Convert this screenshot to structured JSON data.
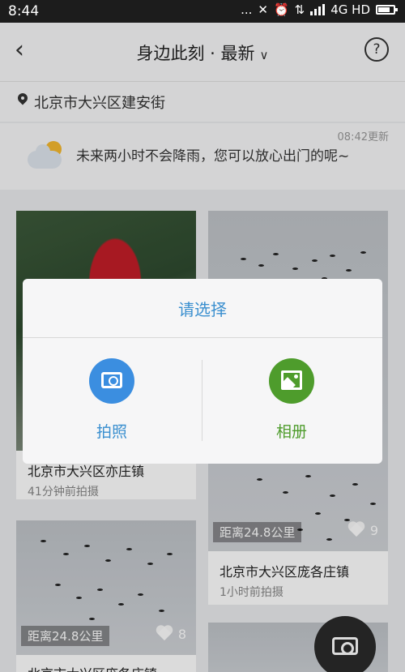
{
  "statusbar": {
    "time": "8:44",
    "dots": "...",
    "network": "4G HD"
  },
  "navbar": {
    "title": "身边此刻 · 最新",
    "help": "?"
  },
  "location": {
    "text": "北京市大兴区建安街"
  },
  "weather": {
    "updated": "08:42更新",
    "message": "未来两小时不会降雨，您可以放心出门的呢~"
  },
  "cards": [
    {
      "place": "北京市大兴区亦庄镇",
      "ago": "41分钟前拍摄"
    },
    {
      "distance": "距离24.8公里",
      "likes": "9",
      "place": "北京市大兴区庞各庄镇",
      "ago": "1小时前拍摄"
    },
    {
      "distance": "距离24.8公里",
      "likes": "8",
      "place": "北京市大兴区庞各庄镇"
    }
  ],
  "dialog": {
    "title": "请选择",
    "options": [
      {
        "label": "拍照",
        "icon": "camera-icon",
        "color": "#3b8ee0"
      },
      {
        "label": "相册",
        "icon": "album-icon",
        "color": "#4e9c2c"
      }
    ]
  },
  "colors": {
    "accent_blue": "#3a8fcf",
    "accent_green": "#4e9c2c"
  }
}
